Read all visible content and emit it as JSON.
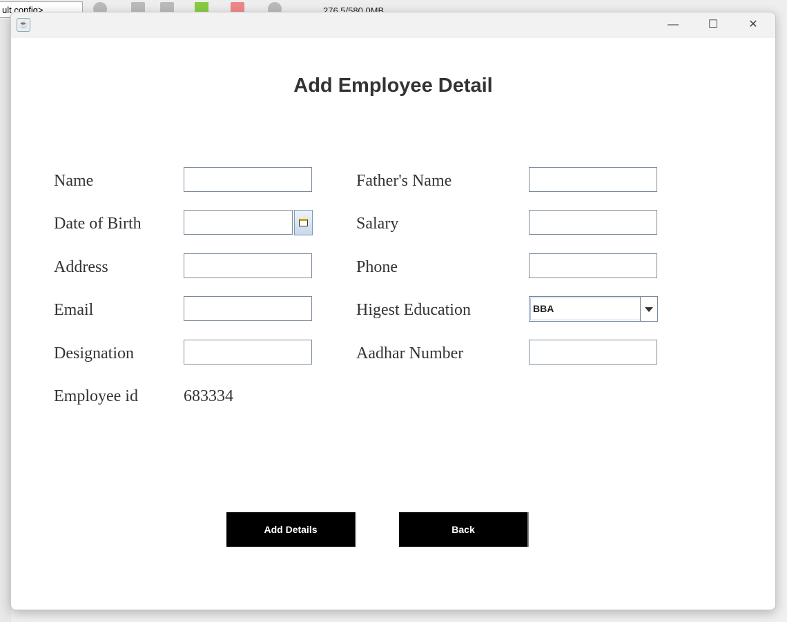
{
  "ide": {
    "config_label": "ult config>",
    "memory": "276.5/580.0MB"
  },
  "window": {
    "minimize": "—",
    "maximize": "☐",
    "close": "✕"
  },
  "form": {
    "title": "Add Employee Detail",
    "left": [
      {
        "label": "Name",
        "value": ""
      },
      {
        "label": "Date of Birth",
        "value": ""
      },
      {
        "label": "Address",
        "value": ""
      },
      {
        "label": "Email",
        "value": ""
      },
      {
        "label": "Designation",
        "value": ""
      }
    ],
    "right": [
      {
        "label": "Father's Name",
        "value": ""
      },
      {
        "label": "Salary",
        "value": ""
      },
      {
        "label": "Phone",
        "value": ""
      },
      {
        "label": "Higest Education",
        "value": "BBA"
      },
      {
        "label": "Aadhar Number",
        "value": ""
      }
    ],
    "employee_id_label": "Employee id",
    "employee_id_value": "683334"
  },
  "buttons": {
    "add": "Add Details",
    "back": "Back"
  }
}
